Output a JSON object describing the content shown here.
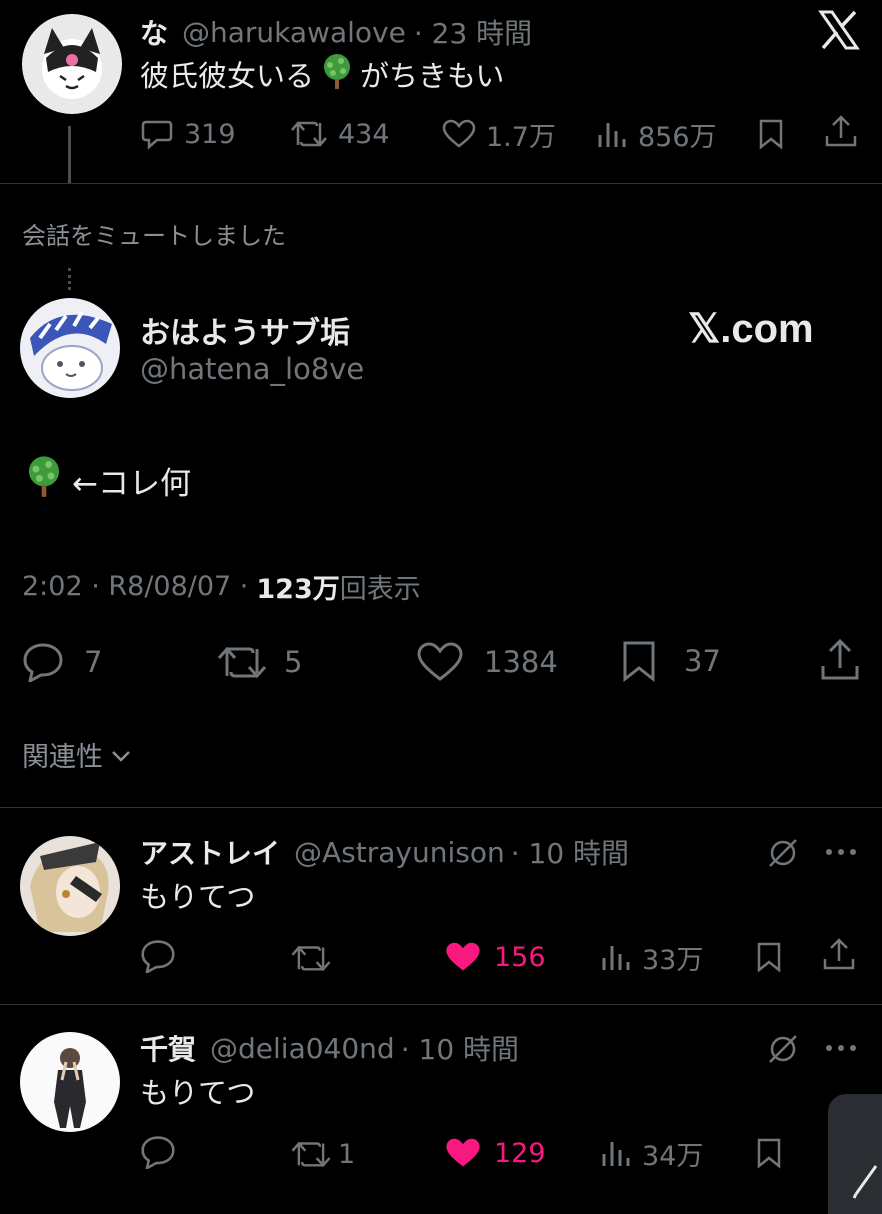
{
  "tweet1": {
    "name": "な",
    "handle": "@harukawalove",
    "time": "· 23 時間",
    "text_before": "彼氏彼女いる",
    "text_after": "がちきもい",
    "replies": "319",
    "reposts": "434",
    "likes": "1.7万",
    "views": "856万"
  },
  "muted_notice": "会話をミュートしました",
  "main": {
    "name": "おはようサブ垢",
    "handle": "@hatena_lo8ve",
    "brand": "𝕏.com",
    "text": "←コレ何",
    "time": "2:02 · R8/08/07 ·",
    "view_count": "123万",
    "view_label": "回表示",
    "replies": "7",
    "reposts": "5",
    "likes": "1384",
    "bookmarks": "37"
  },
  "related": "関連性",
  "reply1": {
    "name": "アストレイ",
    "handle": "@Astrayunison",
    "time": "· 10 時間",
    "text": "もりてつ",
    "reposts": "",
    "likes": "156",
    "views": "33万"
  },
  "reply2": {
    "name": "千賀",
    "handle": "@delia040nd",
    "time": "· 10 時間",
    "text": "もりてつ",
    "reposts": "1",
    "likes": "129",
    "views": "34万"
  },
  "colors": {
    "bg": "#000000",
    "text": "#e7e9ea",
    "muted": "#71767b",
    "like": "#f91880",
    "divider": "#2f3336"
  }
}
